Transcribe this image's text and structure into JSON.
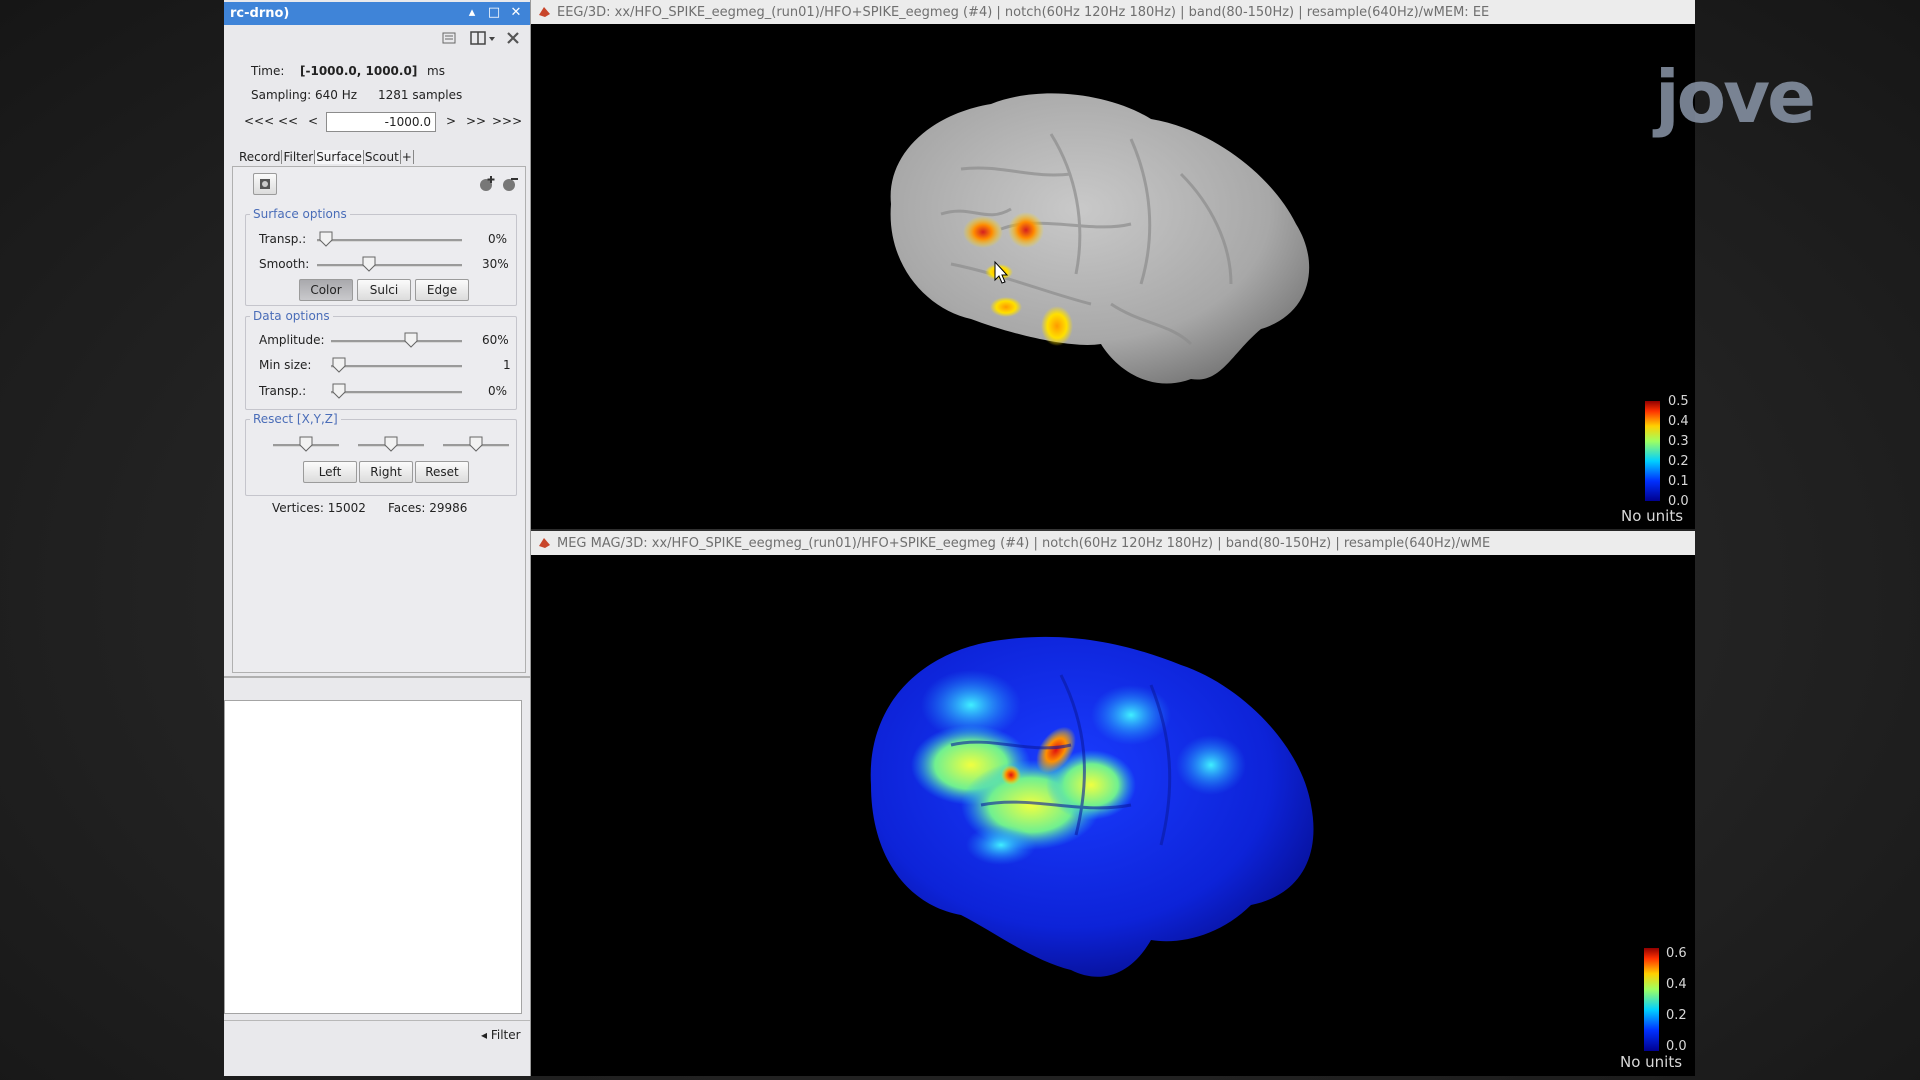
{
  "panel": {
    "title": "rc-drno)",
    "time_label": "Time:",
    "time_value": "[-1000.0, 1000.0]",
    "time_unit": "ms",
    "sampling": "Sampling: 640 Hz",
    "samples": "1281 samples",
    "nav": [
      "<<<",
      "<<",
      "<",
      ">",
      ">>",
      ">>>"
    ],
    "time_input": "-1000.0",
    "tabs": [
      "Record",
      "Filter",
      "Surface",
      "Scout",
      "+"
    ],
    "active_tab": "Surface",
    "surface_options": {
      "title": "Surface options",
      "transp_label": "Transp.:",
      "transp_value": "0%",
      "smooth_label": "Smooth:",
      "smooth_value": "30%",
      "buttons": [
        "Color",
        "Sulci",
        "Edge"
      ]
    },
    "data_options": {
      "title": "Data options",
      "amplitude_label": "Amplitude:",
      "amplitude_value": "60%",
      "minsize_label": "Min size:",
      "minsize_value": "1",
      "transp_label": "Transp.:",
      "transp_value": "0%"
    },
    "resect": {
      "title": "Resect [X,Y,Z]",
      "buttons": [
        "Left",
        "Right",
        "Reset"
      ]
    },
    "vertices": "Vertices: 15002",
    "faces": "Faces: 29986",
    "filter_label": "Filter"
  },
  "figures": {
    "top": {
      "title": "EEG/3D: xx/HFO_SPIKE_eegmeg_(run01)/HFO+SPIKE_eegmeg (#4) | notch(60Hz 120Hz 180Hz) | band(80-150Hz) | resample(640Hz)/wMEM: EE",
      "colorbar_ticks": [
        "0.5",
        "0.4",
        "0.3",
        "0.2",
        "0.1",
        "0.0"
      ],
      "units": "No units"
    },
    "bottom": {
      "title": "MEG MAG/3D: xx/HFO_SPIKE_eegmeg_(run01)/HFO+SPIKE_eegmeg (#4) | notch(60Hz 120Hz 180Hz) | band(80-150Hz) | resample(640Hz)/wME",
      "colorbar_ticks": [
        "0.6",
        "0.4",
        "0.2",
        "0.0"
      ],
      "units": "No units"
    }
  },
  "watermark": "jove",
  "colors": {
    "title_bar": "#3f84d8",
    "group_title": "#4a6db8",
    "watermark": "#8a96a8"
  }
}
